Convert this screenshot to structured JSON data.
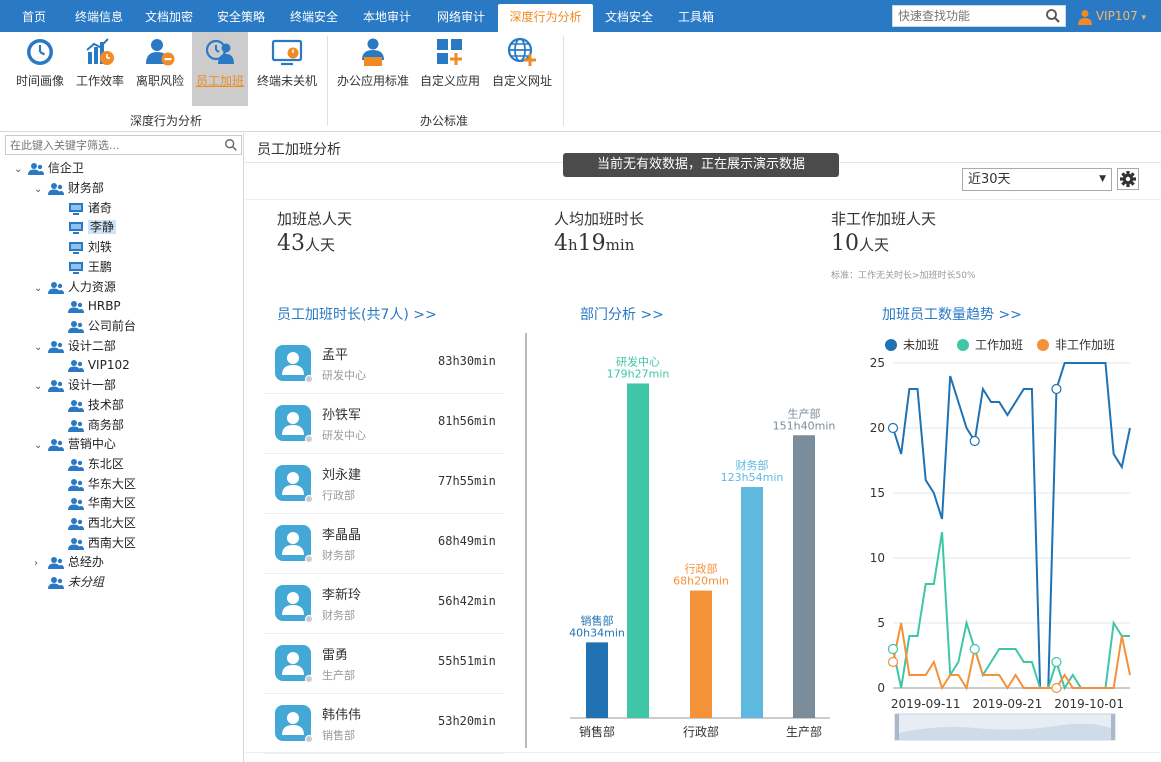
{
  "nav": {
    "tabs": [
      {
        "label": "首页"
      },
      {
        "label": "终端信息"
      },
      {
        "label": "文档加密"
      },
      {
        "label": "安全策略"
      },
      {
        "label": "终端安全"
      },
      {
        "label": "本地审计"
      },
      {
        "label": "网络审计"
      },
      {
        "label": "深度行为分析",
        "active": true
      },
      {
        "label": "文档安全"
      },
      {
        "label": "工具箱"
      }
    ],
    "search_placeholder": "快速查找功能",
    "user": "VIP107",
    "user_caret": "▾"
  },
  "ribbon": {
    "buttons": [
      {
        "label": "时间画像",
        "icon": "clock-icon"
      },
      {
        "label": "工作效率",
        "icon": "efficiency-chart-icon"
      },
      {
        "label": "离职风险",
        "icon": "resign-risk-icon"
      },
      {
        "label": "员工加班",
        "icon": "overtime-icon",
        "active": true
      },
      {
        "label": "终端未关机",
        "icon": "monitor-power-icon"
      },
      {
        "label": "办公应用标准",
        "icon": "office-app-icon"
      },
      {
        "label": "自定义应用",
        "icon": "custom-app-icon"
      },
      {
        "label": "自定义网址",
        "icon": "custom-url-icon"
      }
    ],
    "groups": [
      "深度行为分析",
      "办公标准"
    ]
  },
  "tree": {
    "filter_placeholder": "在此键入关键字筛选...",
    "nodes": [
      {
        "label": "信企卫",
        "type": "group",
        "caret": "expanded"
      },
      {
        "label": "财务部",
        "type": "group",
        "caret": "expanded"
      },
      {
        "label": "诸奇",
        "type": "terminal"
      },
      {
        "label": "李静",
        "type": "terminal",
        "selected": true
      },
      {
        "label": "刘轶",
        "type": "terminal"
      },
      {
        "label": "王鹏",
        "type": "terminal"
      },
      {
        "label": "人力资源",
        "type": "group",
        "caret": "expanded"
      },
      {
        "label": "HRBP",
        "type": "group"
      },
      {
        "label": "公司前台",
        "type": "group"
      },
      {
        "label": "设计二部",
        "type": "group",
        "caret": "expanded"
      },
      {
        "label": "VIP102",
        "type": "group"
      },
      {
        "label": "设计一部",
        "type": "group",
        "caret": "expanded"
      },
      {
        "label": "技术部",
        "type": "group"
      },
      {
        "label": "商务部",
        "type": "group"
      },
      {
        "label": "营销中心",
        "type": "group",
        "caret": "expanded"
      },
      {
        "label": "东北区",
        "type": "group"
      },
      {
        "label": "华东大区",
        "type": "group"
      },
      {
        "label": "华南大区",
        "type": "group"
      },
      {
        "label": "西北大区",
        "type": "group"
      },
      {
        "label": "西南大区",
        "type": "group"
      },
      {
        "label": "总经办",
        "type": "group",
        "caret": "collapsed"
      },
      {
        "label": "未分组",
        "type": "group",
        "italic": true
      }
    ]
  },
  "main": {
    "title": "员工加班分析",
    "demo_banner": "当前无有效数据，正在展示演示数据",
    "period": "近30天",
    "stats": [
      {
        "label": "加班总人天",
        "value": "43",
        "unit": "人天"
      },
      {
        "label": "人均加班时长",
        "value_parts": [
          "4",
          "h",
          "19",
          "min"
        ]
      },
      {
        "label": "非工作加班人天",
        "value": "10",
        "unit": "人天",
        "note": "标准：工作无关时长>加班时长50%"
      }
    ],
    "sections": {
      "employees": "员工加班时长(共7人) >>",
      "departments": "部门分析 >>",
      "trend": "加班员工数量趋势 >>"
    },
    "employees": [
      {
        "name": "孟平",
        "dept": "研发中心",
        "duration": "83h30min"
      },
      {
        "name": "孙铁军",
        "dept": "研发中心",
        "duration": "81h56min"
      },
      {
        "name": "刘永建",
        "dept": "行政部",
        "duration": "77h55min"
      },
      {
        "name": "李晶晶",
        "dept": "财务部",
        "duration": "68h49min"
      },
      {
        "name": "李新玲",
        "dept": "财务部",
        "duration": "56h42min"
      },
      {
        "name": "雷勇",
        "dept": "生产部",
        "duration": "55h51min"
      },
      {
        "name": "韩伟伟",
        "dept": "销售部",
        "duration": "53h20min"
      }
    ]
  },
  "chart_data": [
    {
      "type": "bar",
      "title": "部门分析",
      "categories": [
        "销售部",
        "研发中心",
        "行政部",
        "财务部",
        "生产部"
      ],
      "axis_labels_shown": [
        "销售部",
        "",
        "行政部",
        "",
        "生产部"
      ],
      "values_minutes": [
        2434,
        10767,
        4100,
        7434,
        9100
      ],
      "value_labels": [
        "40h34min",
        "179h27min",
        "68h20min",
        "123h54min",
        "151h40min"
      ],
      "colors": [
        "#2072b2",
        "#3ec6a6",
        "#f4923a",
        "#5fb9df",
        "#7b8c9b"
      ]
    },
    {
      "type": "line",
      "title": "加班员工数量趋势",
      "x": [
        "2019-09-07",
        "2019-09-08",
        "2019-09-09",
        "2019-09-10",
        "2019-09-11",
        "2019-09-12",
        "2019-09-13",
        "2019-09-14",
        "2019-09-15",
        "2019-09-16",
        "2019-09-17",
        "2019-09-18",
        "2019-09-19",
        "2019-09-20",
        "2019-09-21",
        "2019-09-22",
        "2019-09-23",
        "2019-09-24",
        "2019-09-25",
        "2019-09-26",
        "2019-09-27",
        "2019-09-28",
        "2019-09-29",
        "2019-09-30",
        "2019-10-01",
        "2019-10-02",
        "2019-10-03",
        "2019-10-04",
        "2019-10-05",
        "2019-10-06"
      ],
      "x_ticks": [
        "2019-09-11",
        "2019-09-21",
        "2019-10-01"
      ],
      "ylim": [
        0,
        25
      ],
      "y_ticks": [
        0,
        5,
        10,
        15,
        20,
        25
      ],
      "legend_position": "top",
      "series": [
        {
          "name": "未加班",
          "color": "#2072b2",
          "values": [
            20,
            18,
            23,
            23,
            16,
            15,
            13,
            24,
            22,
            20,
            19,
            23,
            22,
            22,
            21,
            22,
            23,
            23,
            0,
            0,
            23,
            25,
            25,
            25,
            25,
            25,
            25,
            18,
            17,
            20
          ]
        },
        {
          "name": "工作加班",
          "color": "#3ec6a6",
          "values": [
            3,
            0,
            4,
            4,
            8,
            8,
            12,
            1,
            2,
            5,
            3,
            1,
            2,
            3,
            3,
            3,
            2,
            2,
            0,
            0,
            2,
            0,
            1,
            0,
            0,
            0,
            0,
            5,
            4,
            4
          ]
        },
        {
          "name": "非工作加班",
          "color": "#f4923a",
          "values": [
            2,
            5,
            1,
            1,
            1,
            2,
            0,
            1,
            1,
            0,
            3,
            1,
            1,
            1,
            0,
            1,
            0,
            0,
            0,
            0,
            0,
            1,
            0,
            0,
            0,
            0,
            0,
            0,
            4,
            1
          ]
        }
      ],
      "marked_points": [
        {
          "series": 0,
          "index": 0
        },
        {
          "series": 0,
          "index": 10
        },
        {
          "series": 0,
          "index": 20
        },
        {
          "series": 1,
          "index": 0
        },
        {
          "series": 1,
          "index": 10
        },
        {
          "series": 1,
          "index": 20
        },
        {
          "series": 2,
          "index": 0
        },
        {
          "series": 2,
          "index": 20
        }
      ]
    }
  ]
}
